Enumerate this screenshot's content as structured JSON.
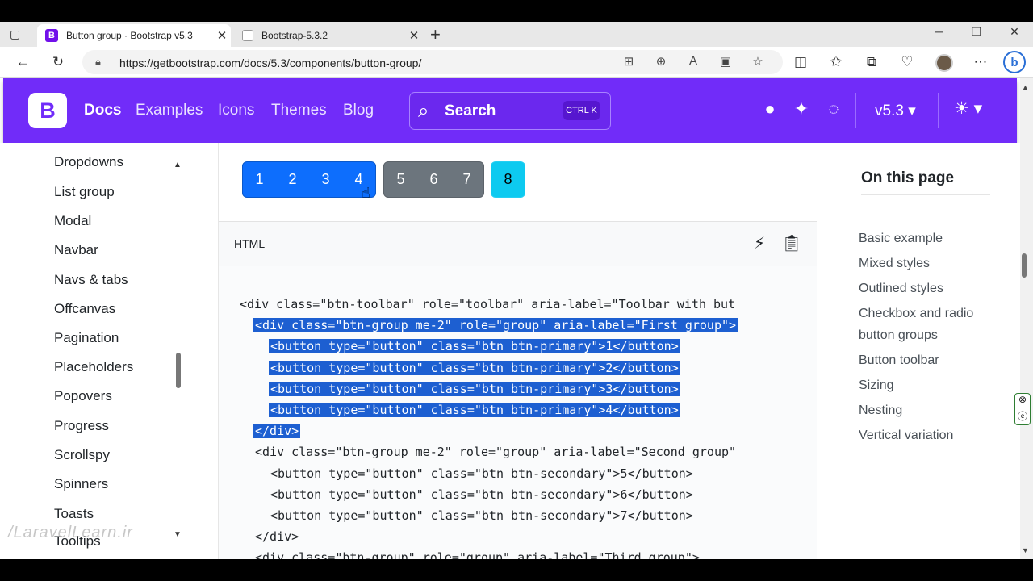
{
  "browser": {
    "tabs": [
      {
        "favicon": "B",
        "title": "Button group · Bootstrap v5.3",
        "active": true
      },
      {
        "favicon": "",
        "title": "Bootstrap-5.3.2",
        "active": false
      }
    ],
    "new_tab": "+",
    "url": "https://getbootstrap.com/docs/5.3/components/button-group/"
  },
  "navbar": {
    "logo": "B",
    "links": [
      {
        "label": "Docs",
        "active": true
      },
      {
        "label": "Examples",
        "active": false
      },
      {
        "label": "Icons",
        "active": false
      },
      {
        "label": "Themes",
        "active": false
      },
      {
        "label": "Blog",
        "active": false
      }
    ],
    "search_label": "Search",
    "search_kbd": "CTRL K",
    "version": "v5.3 ▾",
    "colors": {
      "brand": "#712cf9"
    }
  },
  "sidebar": {
    "items": [
      "Dropdowns",
      "List group",
      "Modal",
      "Navbar",
      "Navs & tabs",
      "Offcanvas",
      "Pagination",
      "Placeholders",
      "Popovers",
      "Progress",
      "Scrollspy",
      "Spinners",
      "Toasts",
      "Tooltips"
    ],
    "watermark": "/LaravelLearn.ir"
  },
  "demo": {
    "primary_buttons": [
      "1",
      "2",
      "3",
      "4"
    ],
    "secondary_buttons": [
      "5",
      "6",
      "7"
    ],
    "info_buttons": [
      "8"
    ],
    "colors": {
      "primary": "#0d6efd",
      "secondary": "#6c757d",
      "info": "#0dcaf0"
    }
  },
  "code": {
    "language": "HTML",
    "lines": [
      {
        "text": "<div class=\"btn-toolbar\" role=\"toolbar\" aria-label=\"Toolbar with but",
        "indent": 0,
        "selected": false
      },
      {
        "text": "<div class=\"btn-group me-2\" role=\"group\" aria-label=\"First group\">",
        "indent": 1,
        "selected": true
      },
      {
        "text": "<button type=\"button\" class=\"btn btn-primary\">1</button>",
        "indent": 2,
        "selected": true
      },
      {
        "text": "<button type=\"button\" class=\"btn btn-primary\">2</button>",
        "indent": 2,
        "selected": true
      },
      {
        "text": "<button type=\"button\" class=\"btn btn-primary\">3</button>",
        "indent": 2,
        "selected": true
      },
      {
        "text": "<button type=\"button\" class=\"btn btn-primary\">4</button>",
        "indent": 2,
        "selected": true
      },
      {
        "text": "</div>",
        "indent": 1,
        "selected": true
      },
      {
        "text": "<div class=\"btn-group me-2\" role=\"group\" aria-label=\"Second group\"",
        "indent": 1,
        "selected": false
      },
      {
        "text": "<button type=\"button\" class=\"btn btn-secondary\">5</button>",
        "indent": 2,
        "selected": false
      },
      {
        "text": "<button type=\"button\" class=\"btn btn-secondary\">6</button>",
        "indent": 2,
        "selected": false
      },
      {
        "text": "<button type=\"button\" class=\"btn btn-secondary\">7</button>",
        "indent": 2,
        "selected": false
      },
      {
        "text": "</div>",
        "indent": 1,
        "selected": false
      },
      {
        "text": "<div class=\"btn-group\" role=\"group\" aria-label=\"Third group\">",
        "indent": 1,
        "selected": false
      }
    ]
  },
  "toc": {
    "title": "On this page",
    "items": [
      "Basic example",
      "Mixed styles",
      "Outlined styles",
      "Checkbox and radio button groups",
      "Button toolbar",
      "Sizing",
      "Nesting",
      "Vertical variation"
    ]
  }
}
